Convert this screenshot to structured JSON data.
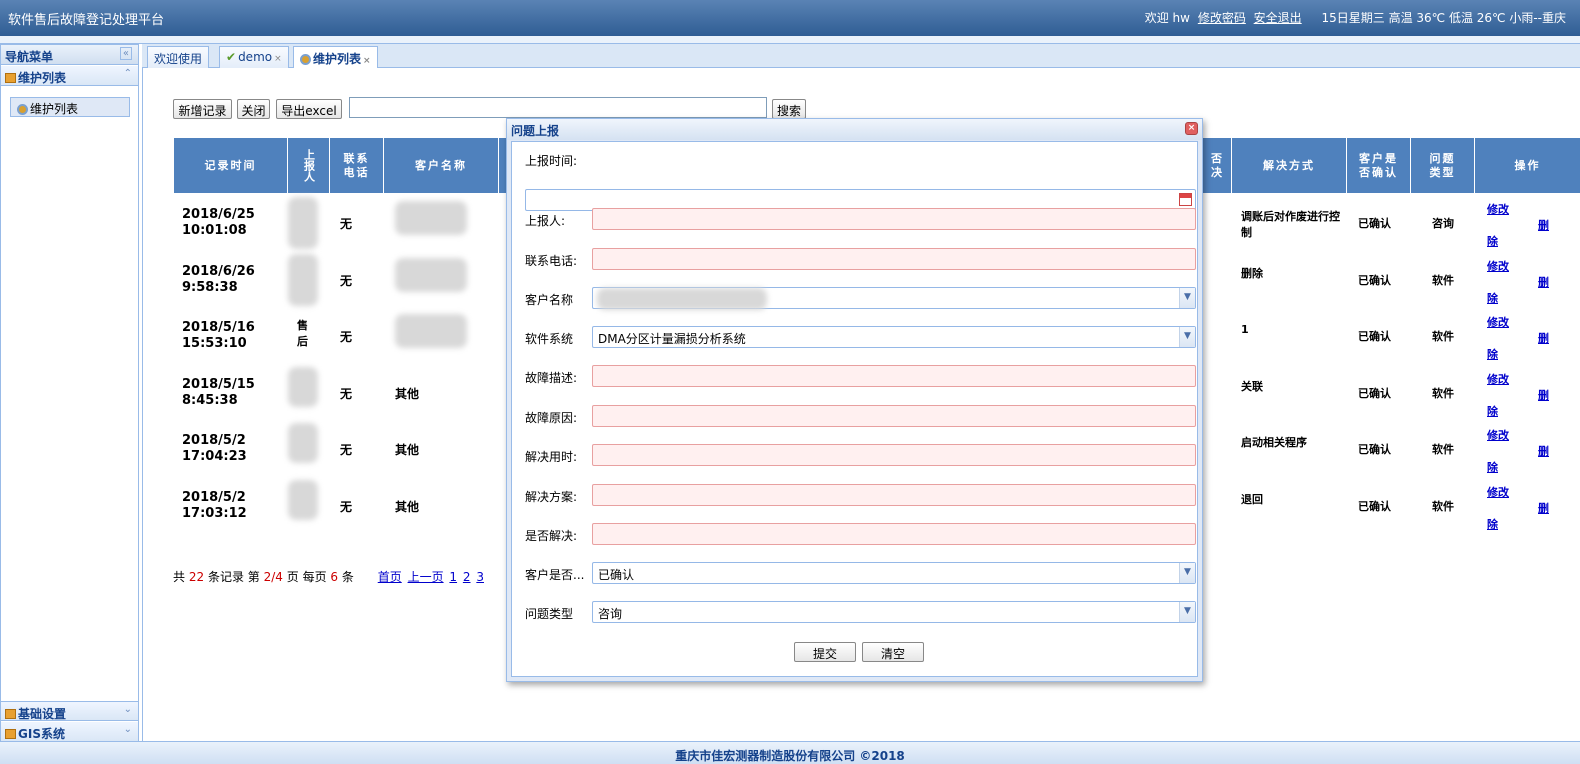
{
  "header": {
    "app_title": "软件售后故障登记处理平台",
    "welcome": "欢迎 hw",
    "change_password": "修改密码",
    "logout": "安全退出",
    "weather": "15日星期三 高温 36℃ 低温 26℃ 小雨--重庆"
  },
  "sidebar": {
    "title": "导航菜单",
    "sections": [
      {
        "label": "维护列表",
        "items": [
          "维护列表"
        ]
      },
      {
        "label": "基础设置"
      },
      {
        "label": "GIS系统"
      }
    ]
  },
  "tabs": [
    {
      "label": "欢迎使用"
    },
    {
      "label": "demo"
    },
    {
      "label": "维护列表"
    }
  ],
  "toolbar": {
    "add": "新增记录",
    "close": "关闭",
    "export": "导出excel",
    "search_value": "",
    "search": "搜索"
  },
  "table": {
    "headers_left": [
      "记录时间",
      "上报人",
      "联系电话",
      "客户名称"
    ],
    "headers_right": [
      "否决",
      "解决方式",
      "客户是否确认",
      "问题类型",
      "操作"
    ],
    "rows": [
      {
        "time": "2018/6/25 10:01:08",
        "phone": "无",
        "customer": "",
        "method": "调账后对作废进行控制",
        "confirm": "已确认",
        "type": "咨询",
        "edit": "修改",
        "del_a": "删",
        "del_b": "除"
      },
      {
        "time": "2018/6/26 9:58:38",
        "phone": "无",
        "customer": "",
        "method": "删除",
        "confirm": "已确认",
        "type": "软件",
        "edit": "修改",
        "del_a": "删",
        "del_b": "除"
      },
      {
        "time": "2018/5/16 15:53:10",
        "reporter": "售后",
        "phone": "无",
        "customer": "",
        "method": "1",
        "confirm": "已确认",
        "type": "软件",
        "edit": "修改",
        "del_a": "删",
        "del_b": "除"
      },
      {
        "time": "2018/5/15 8:45:38",
        "phone": "无",
        "customer": "其他",
        "method": "关联",
        "confirm": "已确认",
        "type": "软件",
        "edit": "修改",
        "del_a": "删",
        "del_b": "除"
      },
      {
        "time": "2018/5/2 17:04:23",
        "phone": "无",
        "customer": "其他",
        "method": "启动相关程序",
        "confirm": "已确认",
        "type": "软件",
        "edit": "修改",
        "del_a": "删",
        "del_b": "除"
      },
      {
        "time": "2018/5/2 17:03:12",
        "phone": "无",
        "customer": "其他",
        "method": "退回",
        "confirm": "已确认",
        "type": "软件",
        "edit": "修改",
        "del_a": "删",
        "del_b": "除"
      }
    ]
  },
  "pager": {
    "prefix": "共",
    "total": "22",
    "records": "条记录 第",
    "page": "2/4",
    "page_word": "页 每页",
    "per_page": "6",
    "unit": "条",
    "first": "首页",
    "prev": "上一页",
    "p1": "1",
    "p2": "2",
    "p3": "3"
  },
  "dialog": {
    "title": "问题上报",
    "report_time_label": "上报时间:",
    "reporter_label": "上报人:",
    "phone_label": "联系电话:",
    "customer_label": "客户名称",
    "system_label": "软件系统",
    "system_value": "DMA分区计量漏损分析系统",
    "fault_desc_label": "故障描述:",
    "fault_reason_label": "故障原因:",
    "solve_time_label": "解决用时:",
    "solution_label": "解决方案:",
    "solved_label": "是否解决:",
    "confirm_label": "客户是否...",
    "confirm_value": "已确认",
    "type_label": "问题类型",
    "type_value": "咨询",
    "submit": "提交",
    "clear": "清空"
  },
  "footer": {
    "copyright": "重庆市佳宏测器制造股份有限公司 ©2018"
  }
}
